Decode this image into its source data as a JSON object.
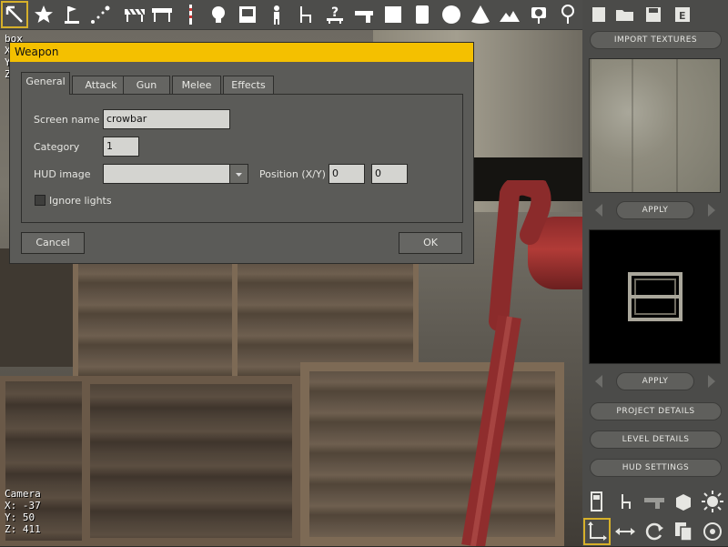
{
  "toolbar": {
    "tools": [
      "select-arrow-icon",
      "star-icon",
      "flag-icon",
      "path-icon",
      "barrier-icon",
      "divider-icon",
      "lightbulb-icon",
      "screen-icon",
      "person-icon",
      "chair-icon",
      "question-sign-icon",
      "gun-icon",
      "square-icon",
      "door-icon",
      "sphere-icon",
      "cone-icon",
      "terrain-icon",
      "sign-icon",
      "tree-icon"
    ]
  },
  "viewport": {
    "top_info": [
      "box",
      "X",
      "Y",
      "Z"
    ],
    "camera": {
      "label": "Camera",
      "x": "X: -37",
      "y": "Y: 50",
      "z": "Z: 411"
    }
  },
  "dialog": {
    "title": "Weapon",
    "tabs": [
      {
        "label": "General",
        "active": true
      },
      {
        "label": "Attack",
        "active": false
      },
      {
        "label": "Gun",
        "active": false
      },
      {
        "label": "Melee",
        "active": false
      },
      {
        "label": "Effects",
        "active": false
      }
    ],
    "fields": {
      "screen_name_label": "Screen name",
      "screen_name_value": "crowbar",
      "category_label": "Category",
      "category_value": "1",
      "hud_image_label": "HUD image",
      "hud_image_value": "",
      "position_label": "Position (X/Y)",
      "position_x": "0",
      "position_y": "0",
      "ignore_lights_label": "Ignore lights",
      "ignore_lights_checked": false
    },
    "cancel_label": "Cancel",
    "ok_label": "OK"
  },
  "right_panel": {
    "top_icons": [
      "new-file-icon",
      "open-folder-icon",
      "save-icon",
      "export-icon"
    ],
    "import_textures": "IMPORT TEXTURES",
    "apply_texture": "APPLY",
    "apply_model": "APPLY",
    "project_details": "PROJECT DETAILS",
    "level_details": "LEVEL DETAILS",
    "hud_settings": "HUD SETTINGS",
    "bottom_icons": [
      "door-small-icon",
      "chair-small-icon",
      "gun-small-icon",
      "cube-icon",
      "sun-icon",
      "move-axis-icon",
      "resize-icon",
      "rotate-icon",
      "copy-icon",
      "target-icon"
    ]
  }
}
